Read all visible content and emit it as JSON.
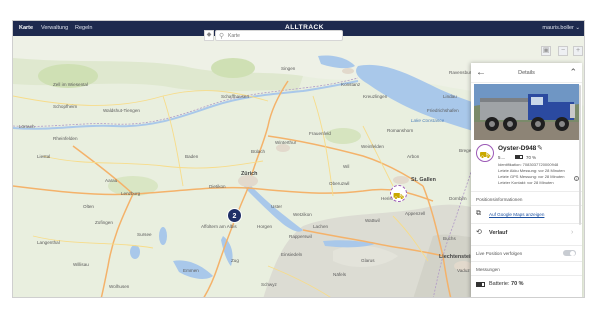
{
  "nav": {
    "items": [
      "Karte",
      "Verwaltung",
      "Regeln"
    ],
    "brand": "ALLTRACK",
    "user": "mauris.boller ⌄"
  },
  "map": {
    "search_placeholder": "Karte",
    "cluster_count": "2",
    "labels": [
      {
        "text": "Zürich",
        "cls": "big"
      },
      {
        "text": "Winterthur",
        "cls": ""
      },
      {
        "text": "Schaffhausen",
        "cls": ""
      },
      {
        "text": "St. Gallen",
        "cls": "big"
      },
      {
        "text": "Konstanz",
        "cls": ""
      },
      {
        "text": "Friedrichshafen",
        "cls": ""
      },
      {
        "text": "Ravensburg",
        "cls": ""
      },
      {
        "text": "Lake Constance",
        "cls": "lake"
      },
      {
        "text": "Bülach",
        "cls": ""
      },
      {
        "text": "Baden",
        "cls": ""
      },
      {
        "text": "Aarau",
        "cls": ""
      },
      {
        "text": "Lenzburg",
        "cls": ""
      },
      {
        "text": "Dietikon",
        "cls": ""
      },
      {
        "text": "Uster",
        "cls": ""
      },
      {
        "text": "Wetzikon",
        "cls": ""
      },
      {
        "text": "Rapperswil",
        "cls": ""
      },
      {
        "text": "Wil",
        "cls": ""
      },
      {
        "text": "Frauenfeld",
        "cls": ""
      },
      {
        "text": "Weinfelden",
        "cls": ""
      },
      {
        "text": "Herisau",
        "cls": ""
      },
      {
        "text": "Appenzell",
        "cls": ""
      },
      {
        "text": "Zug",
        "cls": ""
      },
      {
        "text": "Sursee",
        "cls": ""
      },
      {
        "text": "Schwyz",
        "cls": ""
      },
      {
        "text": "Liechtenstein",
        "cls": "big"
      },
      {
        "text": "Vaduz",
        "cls": ""
      },
      {
        "text": "Singen",
        "cls": ""
      },
      {
        "text": "Waldshut-Tiengen",
        "cls": ""
      },
      {
        "text": "Lörrach",
        "cls": ""
      },
      {
        "text": "Liestal",
        "cls": ""
      },
      {
        "text": "Olten",
        "cls": ""
      },
      {
        "text": "Zofingen",
        "cls": ""
      },
      {
        "text": "Langenthal",
        "cls": ""
      },
      {
        "text": "Willisau",
        "cls": ""
      },
      {
        "text": "Wolhusen",
        "cls": ""
      },
      {
        "text": "Glarus",
        "cls": ""
      },
      {
        "text": "Näfels",
        "cls": ""
      },
      {
        "text": "Buchs",
        "cls": ""
      },
      {
        "text": "Wattwil",
        "cls": ""
      },
      {
        "text": "Zell im Wiesental",
        "cls": ""
      },
      {
        "text": "Schopfheim",
        "cls": ""
      },
      {
        "text": "Rheinfelden",
        "cls": ""
      },
      {
        "text": "Oberuzwil",
        "cls": ""
      },
      {
        "text": "Lindau",
        "cls": ""
      },
      {
        "text": "Dornbirn",
        "cls": ""
      },
      {
        "text": "Bregenz",
        "cls": ""
      },
      {
        "text": "Kreuzlingen",
        "cls": ""
      },
      {
        "text": "Romanshorn",
        "cls": ""
      },
      {
        "text": "Arbon",
        "cls": ""
      },
      {
        "text": "Einsiedeln",
        "cls": ""
      },
      {
        "text": "Lachen",
        "cls": ""
      },
      {
        "text": "Horgen",
        "cls": ""
      },
      {
        "text": "Affoltern am Albis",
        "cls": ""
      },
      {
        "text": "Emmen",
        "cls": ""
      }
    ]
  },
  "panel": {
    "title": "Details",
    "device_name": "Oyster-D948",
    "signal": "5....",
    "battery_pct": "70 %",
    "battery_level": 0.7,
    "meta": [
      "Identifikation: 7083037720000948",
      "Letzte Akku Messung: vor 28 Minuten",
      "Letzte GPS Messung: vor 28 Minuten",
      "Letzter Kontakt: vor 28 Minuten"
    ],
    "positions_header": "Positionsinformationen",
    "google_maps_link": "Auf Google Maps anzeigen",
    "verlauf_label": "Verlauf",
    "live_position_label": "Live Position verfolgen",
    "measurements_header": "Messungen",
    "battery_label": "Batterie:",
    "battery_value": "70 %"
  },
  "colors": {
    "nav_bg": "#1e2a4e",
    "cluster": "#1f2f66",
    "device_ring": "#9b59b6",
    "link": "#1a4fa0"
  }
}
